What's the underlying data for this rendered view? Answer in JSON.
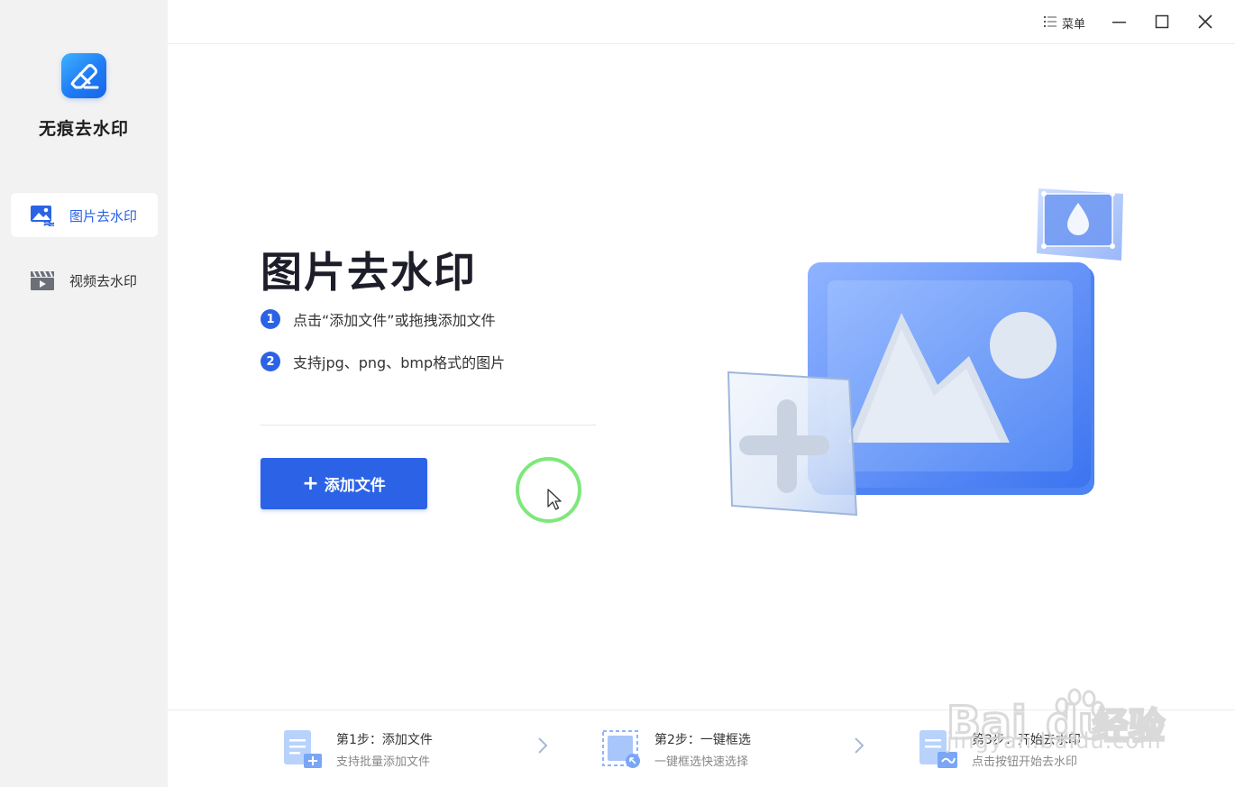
{
  "app": {
    "name": "无痕去水印"
  },
  "sidebar": {
    "items": [
      {
        "label": "图片去水印",
        "icon": "image-watermark-icon",
        "active": true
      },
      {
        "label": "视频去水印",
        "icon": "video-watermark-icon",
        "active": false
      }
    ]
  },
  "titlebar": {
    "menu_label": "菜单",
    "menu_icon": "list-menu-icon"
  },
  "main": {
    "title": "图片去水印",
    "steps": [
      {
        "num": "1",
        "text": "点击“添加文件”或拖拽添加文件"
      },
      {
        "num": "2",
        "text": "支持jpg、png、bmp格式的图片"
      }
    ],
    "add_button": {
      "plus": "+",
      "label": "添加文件"
    }
  },
  "footer": {
    "steps": [
      {
        "title": "第1步：添加文件",
        "subtitle": "支持批量添加文件",
        "icon": "add-file-step-icon"
      },
      {
        "title": "第2步：一键框选",
        "subtitle": "一键框选快速选择",
        "icon": "select-box-step-icon"
      },
      {
        "title": "第3步：开始去水印",
        "subtitle": "点击按钮开始去水印",
        "icon": "remove-watermark-step-icon"
      }
    ]
  },
  "watermark": {
    "text": "jingyan.baidu.com"
  },
  "colors": {
    "accent": "#2c63e6",
    "sidebar_bg": "#f2f2f3",
    "cursor_ring": "#7ee87a"
  }
}
